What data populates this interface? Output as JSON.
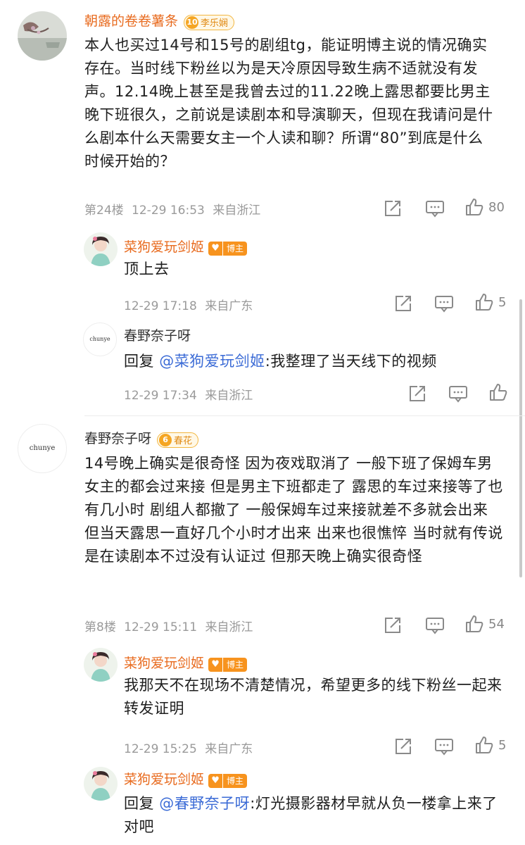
{
  "c1": {
    "author": "朝露的卷卷薯条",
    "badge_level": "10",
    "badge_text": "李乐娴",
    "text": "本人也买过14号和15号的剧组tg，能证明博主说的情况确实存在。当时线下粉丝以为是天冷原因导致生病不适就没有发声。12.14晚上甚至是我曾去过的11.22晚上露思都要比男主晚下班很久，之前说是读剧本和导演聊天，但现在我请问是什么剧本什么天需要女主一个人读和聊？所谓“80”到底是什么时候开始的？",
    "floor": "第24楼",
    "time": "12-29 16:53",
    "location": "来自浙江",
    "likes": "80"
  },
  "r1": {
    "author": "菜狗爱玩剑姬",
    "badge_text": "博主",
    "text": "顶上去",
    "time": "12-29 17:18",
    "location": "来自广东",
    "likes": "5"
  },
  "r2": {
    "author": "春野奈子呀",
    "avatar_text": "chunye",
    "reply_prefix": "回复",
    "mention": "@菜狗爱玩剑姬",
    "text": ":我整理了当天线下的视频",
    "time": "12-29 17:34",
    "location": "来自浙江"
  },
  "c2": {
    "author": "春野奈子呀",
    "avatar_text": "chunye",
    "badge_level": "6",
    "badge_text": "春花",
    "text": "14号晚上确实是很奇怪 因为夜戏取消了 一般下班了保姆车男女主的都会过来接 但是男主下班都走了 露思的车过来接等了也有几小时 剧组人都撤了 一般保姆车过来接就差不多就会出来 但当天露思一直好几个小时才出来 出来也很憔悴 当时就有传说是在读剧本不过没有认证过 但那天晚上确实很奇怪",
    "floor": "第8楼",
    "time": "12-29 15:11",
    "location": "来自浙江",
    "likes": "54"
  },
  "r3": {
    "author": "菜狗爱玩剑姬",
    "badge_text": "博主",
    "text": "我那天不在现场不清楚情况，希望更多的线下粉丝一起来转发证明",
    "time": "12-29 15:25",
    "location": "来自广东",
    "likes": "5"
  },
  "r4": {
    "author": "菜狗爱玩剑姬",
    "badge_text": "博主",
    "reply_prefix": "回复",
    "mention": "@春野奈子呀",
    "text": ":灯光摄影器材早就从负一楼拿上来了对吧"
  }
}
